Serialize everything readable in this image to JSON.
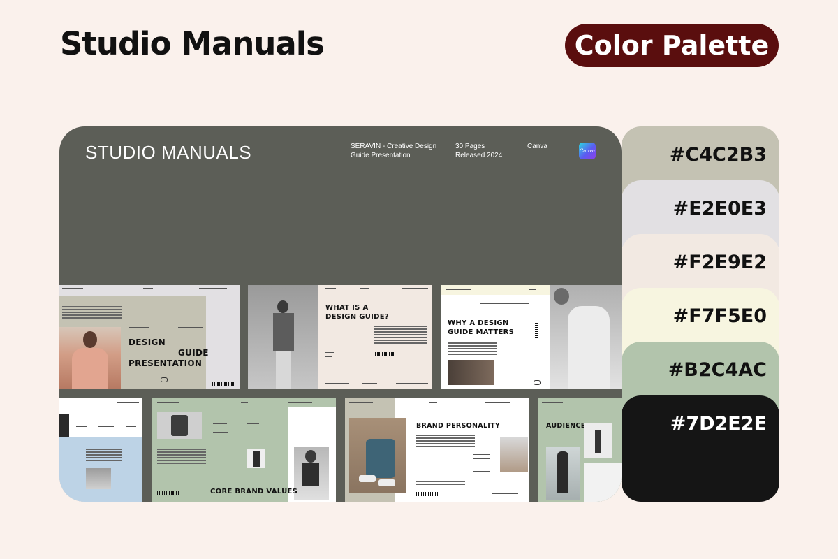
{
  "header": {
    "title": "Studio Manuals",
    "badge": "Color Palette"
  },
  "preview": {
    "title": "STUDIO MANUALS",
    "meta": {
      "name_line1": "SERAVIN - Creative Design",
      "name_line2": "Guide Presentation",
      "pages": "30 Pages",
      "released": "Released 2024",
      "platform": "Canva",
      "platform_icon": "Canva"
    },
    "slides": {
      "s1_line1": "DESIGN",
      "s1_line2": "GUIDE",
      "s1_line3": "PRESENTATION",
      "s2_line1": "WHAT IS A",
      "s2_line2": "DESIGN GUIDE?",
      "s3_line1": "WHY A DESIGN",
      "s3_line2": "GUIDE MATTERS",
      "s5": "CORE BRAND VALUES",
      "s6": "BRAND PERSONALITY",
      "s7": "AUDIENCE"
    }
  },
  "palette": [
    {
      "hex": "#C4C2B3",
      "color": "#C4C2B3",
      "text_color": "#111111"
    },
    {
      "hex": "#E2E0E3",
      "color": "#E2E0E3",
      "text_color": "#111111"
    },
    {
      "hex": "#F2E9E2",
      "color": "#F2E9E2",
      "text_color": "#111111"
    },
    {
      "hex": "#F7F5E0",
      "color": "#F7F5E0",
      "text_color": "#111111"
    },
    {
      "hex": "#B2C4AC",
      "color": "#B2C4AC",
      "text_color": "#111111"
    },
    {
      "hex": "#7D2E2E",
      "color": "#151515",
      "text_color": "#FFFFFF"
    }
  ]
}
